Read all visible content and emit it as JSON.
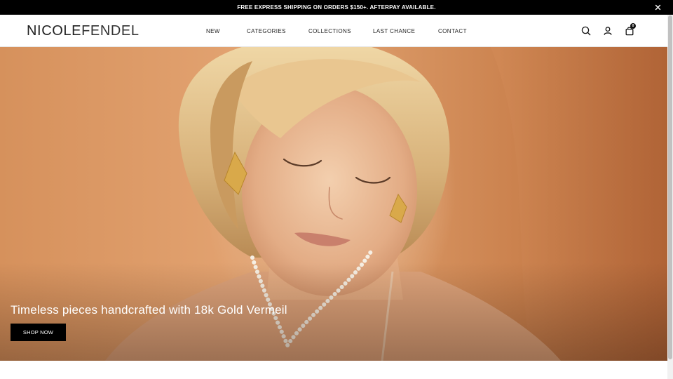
{
  "announcement": {
    "text": "FREE EXPRESS SHIPPING ON ORDERS $150+. AFTERPAY AVAILABLE.",
    "close_icon": "close-icon"
  },
  "header": {
    "logo_part1": "NICOLE",
    "logo_part2": "FENDEL",
    "nav": [
      {
        "label": "NEW"
      },
      {
        "label": "CATEGORIES"
      },
      {
        "label": "COLLECTIONS"
      },
      {
        "label": "LAST CHANCE"
      },
      {
        "label": "CONTACT"
      }
    ],
    "icons": [
      "search-icon",
      "account-icon",
      "cart-icon"
    ],
    "cart_count": "0"
  },
  "hero": {
    "title": "Timeless pieces handcrafted with 18k Gold Vermeil",
    "button_label": "SHOP NOW",
    "image_subject": "woman-with-gold-earrings-and-pearl-necklace"
  },
  "colors": {
    "announcement_bg": "#000000",
    "button_bg": "#000000",
    "hero_tone": "#d9955f"
  }
}
